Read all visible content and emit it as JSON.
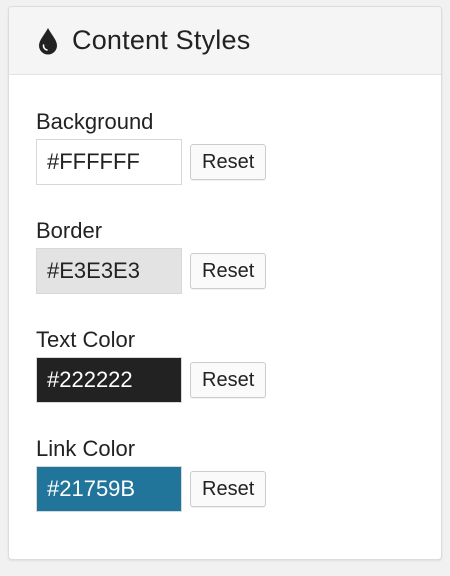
{
  "header": {
    "title": "Content Styles",
    "icon": "drop-icon"
  },
  "fields": [
    {
      "label": "Background",
      "value": "#FFFFFF",
      "swatch_bg": "#FFFFFF",
      "text_color": "#222222",
      "reset_label": "Reset"
    },
    {
      "label": "Border",
      "value": "#E3E3E3",
      "swatch_bg": "#E3E3E3",
      "text_color": "#222222",
      "reset_label": "Reset"
    },
    {
      "label": "Text Color",
      "value": "#222222",
      "swatch_bg": "#222222",
      "text_color": "#FFFFFF",
      "reset_label": "Reset"
    },
    {
      "label": "Link Color",
      "value": "#21759B",
      "swatch_bg": "#21759B",
      "text_color": "#FFFFFF",
      "reset_label": "Reset"
    }
  ]
}
